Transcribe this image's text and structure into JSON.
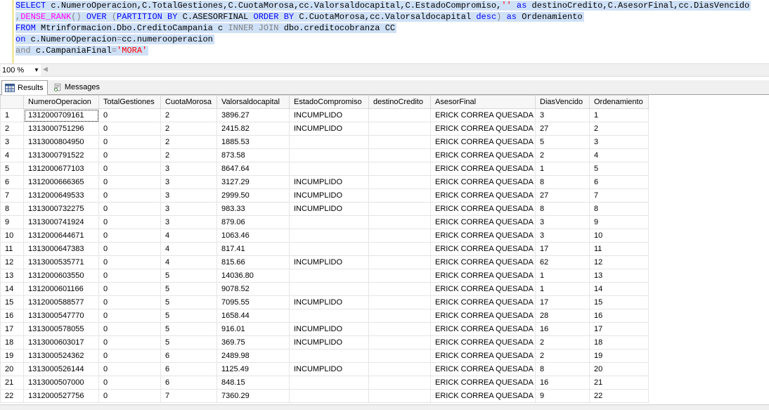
{
  "editor": {
    "lines": [
      [
        {
          "t": "SELECT ",
          "c": "kw"
        },
        {
          "t": "c.NumeroOperacion,C.TotalGestiones,C.CuotaMorosa,cc.Valorsaldocapital,C.EstadoCompromiso,",
          "c": "tx"
        },
        {
          "t": "''",
          "c": "st"
        },
        {
          "t": " as ",
          "c": "kw"
        },
        {
          "t": "destinoCredito,C.AsesorFinal,cc.DiasVencido",
          "c": "tx"
        }
      ],
      [
        {
          "t": ",",
          "c": "gy"
        },
        {
          "t": "DENSE_RANK",
          "c": "fn"
        },
        {
          "t": "() ",
          "c": "gy"
        },
        {
          "t": "OVER ",
          "c": "kw"
        },
        {
          "t": "(",
          "c": "gy"
        },
        {
          "t": "PARTITION BY ",
          "c": "kw"
        },
        {
          "t": "C.ASESORFINAL ",
          "c": "tx"
        },
        {
          "t": "ORDER BY ",
          "c": "kw"
        },
        {
          "t": "C.CuotaMorosa,cc.Valorsaldocapital ",
          "c": "tx"
        },
        {
          "t": "desc",
          "c": "kw"
        },
        {
          "t": ") ",
          "c": "gy"
        },
        {
          "t": "as ",
          "c": "kw"
        },
        {
          "t": "Ordenamiento",
          "c": "tx"
        }
      ],
      [
        {
          "t": "FROM ",
          "c": "kw"
        },
        {
          "t": "Mtrinformacion.Dbo.CreditoCampania c ",
          "c": "tx"
        },
        {
          "t": "INNER JOIN ",
          "c": "gy"
        },
        {
          "t": "dbo.creditocobranza CC",
          "c": "tx"
        }
      ],
      [
        {
          "t": "on ",
          "c": "kw"
        },
        {
          "t": "c.NumeroOperacion",
          "c": "tx"
        },
        {
          "t": "=",
          "c": "gy"
        },
        {
          "t": "cc.numerooperacion",
          "c": "tx"
        }
      ],
      [
        {
          "t": "and ",
          "c": "gy"
        },
        {
          "t": "c.CampaniaFinal",
          "c": "tx"
        },
        {
          "t": "=",
          "c": "gy"
        },
        {
          "t": "'MORA'",
          "c": "st"
        }
      ]
    ]
  },
  "zoom": {
    "value": "100 %"
  },
  "tabs": {
    "results": "Results",
    "messages": "Messages"
  },
  "grid": {
    "columns": [
      "NumeroOperacion",
      "TotalGestiones",
      "CuotaMorosa",
      "Valorsaldocapital",
      "EstadoCompromiso",
      "destinoCredito",
      "AsesorFinal",
      "DiasVencido",
      "Ordenamiento"
    ],
    "rows": [
      [
        "1",
        "1312000709161",
        "0",
        "2",
        "3896.27",
        "INCUMPLIDO",
        "",
        "ERICK CORREA QUESADA",
        "3",
        "1"
      ],
      [
        "2",
        "1313000751296",
        "0",
        "2",
        "2415.82",
        "INCUMPLIDO",
        "",
        "ERICK CORREA QUESADA",
        "27",
        "2"
      ],
      [
        "3",
        "1313000804950",
        "0",
        "2",
        "1885.53",
        "",
        "",
        "ERICK CORREA QUESADA",
        "5",
        "3"
      ],
      [
        "4",
        "1313000791522",
        "0",
        "2",
        "873.58",
        "",
        "",
        "ERICK CORREA QUESADA",
        "2",
        "4"
      ],
      [
        "5",
        "1312000677103",
        "0",
        "3",
        "8647.64",
        "",
        "",
        "ERICK CORREA QUESADA",
        "1",
        "5"
      ],
      [
        "6",
        "1312000666365",
        "0",
        "3",
        "3127.29",
        "INCUMPLIDO",
        "",
        "ERICK CORREA QUESADA",
        "8",
        "6"
      ],
      [
        "7",
        "1312000649533",
        "0",
        "3",
        "2999.50",
        "INCUMPLIDO",
        "",
        "ERICK CORREA QUESADA",
        "27",
        "7"
      ],
      [
        "8",
        "1313000732275",
        "0",
        "3",
        "983.33",
        "INCUMPLIDO",
        "",
        "ERICK CORREA QUESADA",
        "8",
        "8"
      ],
      [
        "9",
        "1313000741924",
        "0",
        "3",
        "879.06",
        "",
        "",
        "ERICK CORREA QUESADA",
        "3",
        "9"
      ],
      [
        "10",
        "1312000644671",
        "0",
        "4",
        "1063.46",
        "",
        "",
        "ERICK CORREA QUESADA",
        "3",
        "10"
      ],
      [
        "11",
        "1313000647383",
        "0",
        "4",
        "817.41",
        "",
        "",
        "ERICK CORREA QUESADA",
        "17",
        "11"
      ],
      [
        "12",
        "1313000535771",
        "0",
        "4",
        "815.66",
        "INCUMPLIDO",
        "",
        "ERICK CORREA QUESADA",
        "62",
        "12"
      ],
      [
        "13",
        "1312000603550",
        "0",
        "5",
        "14036.80",
        "",
        "",
        "ERICK CORREA QUESADA",
        "1",
        "13"
      ],
      [
        "14",
        "1312000601166",
        "0",
        "5",
        "9078.52",
        "",
        "",
        "ERICK CORREA QUESADA",
        "1",
        "14"
      ],
      [
        "15",
        "1312000588577",
        "0",
        "5",
        "7095.55",
        "INCUMPLIDO",
        "",
        "ERICK CORREA QUESADA",
        "17",
        "15"
      ],
      [
        "16",
        "1313000547770",
        "0",
        "5",
        "1658.44",
        "",
        "",
        "ERICK CORREA QUESADA",
        "28",
        "16"
      ],
      [
        "17",
        "1313000578055",
        "0",
        "5",
        "916.01",
        "INCUMPLIDO",
        "",
        "ERICK CORREA QUESADA",
        "16",
        "17"
      ],
      [
        "18",
        "1313000603017",
        "0",
        "5",
        "369.75",
        "INCUMPLIDO",
        "",
        "ERICK CORREA QUESADA",
        "2",
        "18"
      ],
      [
        "19",
        "1313000524362",
        "0",
        "6",
        "2489.98",
        "",
        "",
        "ERICK CORREA QUESADA",
        "2",
        "19"
      ],
      [
        "20",
        "1313000526144",
        "0",
        "6",
        "1125.49",
        "INCUMPLIDO",
        "",
        "ERICK CORREA QUESADA",
        "8",
        "20"
      ],
      [
        "21",
        "1313000507000",
        "0",
        "6",
        "848.15",
        "",
        "",
        "ERICK CORREA QUESADA",
        "16",
        "21"
      ],
      [
        "22",
        "1312000527756",
        "0",
        "7",
        "7360.29",
        "",
        "",
        "ERICK CORREA QUESADA",
        "9",
        "22"
      ]
    ]
  }
}
